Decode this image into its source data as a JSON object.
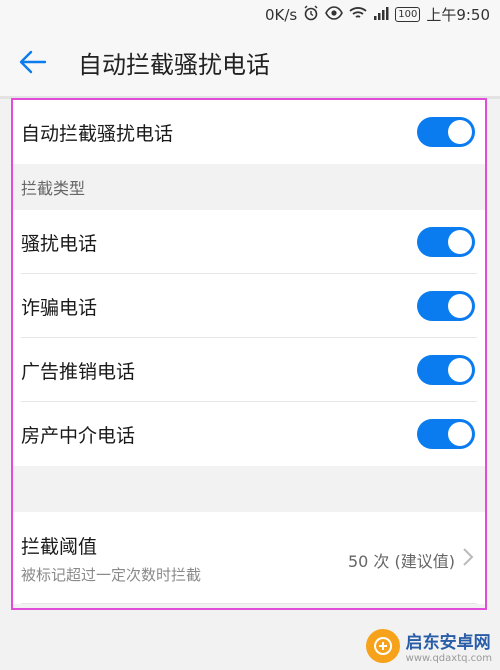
{
  "status_bar": {
    "speed": "0K/s",
    "battery": "100",
    "time": "上午9:50",
    "icons": [
      "alarm-icon",
      "eye-icon",
      "wifi-icon",
      "signal-icon",
      "battery-icon"
    ]
  },
  "app_bar": {
    "back_icon": "back-arrow-icon",
    "title": "自动拦截骚扰电话"
  },
  "main_toggle": {
    "label": "自动拦截骚扰电话",
    "on": true
  },
  "section": {
    "header": "拦截类型"
  },
  "types": [
    {
      "label": "骚扰电话",
      "on": true
    },
    {
      "label": "诈骗电话",
      "on": true
    },
    {
      "label": "广告推销电话",
      "on": true
    },
    {
      "label": "房产中介电话",
      "on": true
    }
  ],
  "threshold": {
    "title": "拦截阈值",
    "subtitle": "被标记超过一定次数时拦截",
    "value": "50 次 (建议值)",
    "icon": "chevron-right-icon"
  },
  "watermark": {
    "name": "启东安卓网",
    "url": "www.qdaxtq.com"
  },
  "colors": {
    "accent": "#0a7cf0",
    "highlight": "#e14dd9",
    "background": "#f2f2f2"
  }
}
